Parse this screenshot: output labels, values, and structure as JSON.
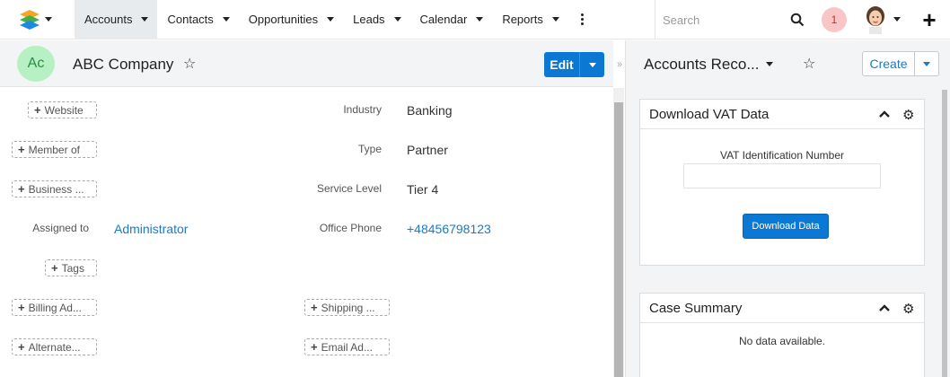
{
  "nav": {
    "tabs": [
      {
        "label": "Accounts",
        "active": true
      },
      {
        "label": "Contacts"
      },
      {
        "label": "Opportunities"
      },
      {
        "label": "Leads"
      },
      {
        "label": "Calendar"
      },
      {
        "label": "Reports"
      }
    ],
    "search_placeholder": "Search",
    "notification_count": "1",
    "icons": [
      "logo-icon",
      "more-vertical-icon",
      "search-icon",
      "user-avatar",
      "plus-icon"
    ]
  },
  "record": {
    "avatar_initials": "Ac",
    "name": "ABC Company",
    "edit_label": "Edit",
    "add_buttons": {
      "website": "Website",
      "member_of": "Member of",
      "business": "Business ...",
      "tags": "Tags",
      "billing": "Billing Ad...",
      "shipping": "Shipping ...",
      "alternate": "Alternate...",
      "email": "Email Ad..."
    },
    "fields": {
      "industry_label": "Industry",
      "industry_value": "Banking",
      "type_label": "Type",
      "type_value": "Partner",
      "service_label": "Service Level",
      "service_value": "Tier 4",
      "assigned_label": "Assigned to",
      "assigned_value": "Administrator",
      "phone_label": "Office Phone",
      "phone_value": "+48456798123"
    }
  },
  "sidebar": {
    "title": "Accounts Reco...",
    "create_label": "Create",
    "dashlets": {
      "vat": {
        "title": "Download VAT Data",
        "field_label": "VAT Identification Number",
        "field_value": "",
        "button_label": "Download Data"
      },
      "cases": {
        "title": "Case Summary",
        "empty_text": "No data available."
      }
    }
  },
  "colors": {
    "accent": "#0b78d4",
    "link": "#1b7ac6",
    "badge_bg": "#f8c6c6",
    "avatar_bg": "#b6f0c3"
  }
}
